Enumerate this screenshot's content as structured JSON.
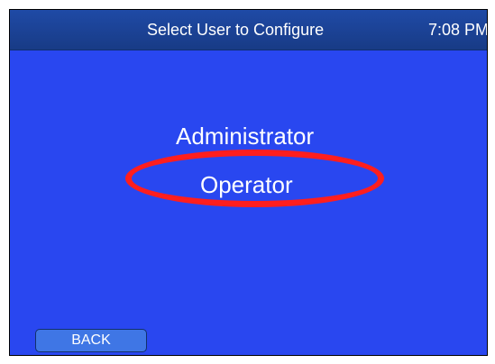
{
  "header": {
    "title": "Select User to Configure",
    "clock": "7:08 PM"
  },
  "menu": {
    "items": [
      {
        "label": "Administrator"
      },
      {
        "label": "Operator",
        "highlighted": true
      }
    ]
  },
  "footer": {
    "back_label": "BACK"
  },
  "colors": {
    "screen_background": "#2947f0",
    "title_bar": "#1f4aa6",
    "highlight_ring": "#ff1e1e",
    "button": "#3f76e5",
    "text": "#ffffff"
  }
}
